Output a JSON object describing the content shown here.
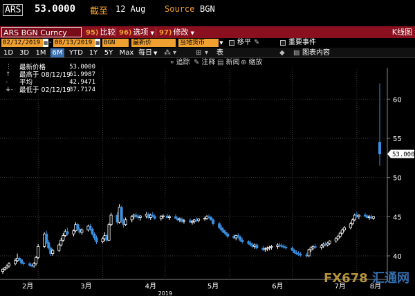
{
  "header": {
    "ticker": "ARS",
    "last_price": "53.0000",
    "asof_label": "截至",
    "asof_date": "12 Aug",
    "source_label": "Source",
    "source_value": "BGN"
  },
  "toolbar": {
    "security": "ARS BGN Curncy",
    "compare_num": "95)",
    "compare_label": "比较",
    "options_num": "96)",
    "options_label": "选项",
    "edit_num": "97)",
    "edit_label": "修改",
    "chart_type": "K线图"
  },
  "params": {
    "start_date": "02/12/2019",
    "end_date": "08/13/2019",
    "pricing_source": "BGN",
    "field": "最新价",
    "currency": "当地货币",
    "move_label": "移平",
    "events_label": "重要事件"
  },
  "periods": [
    "1D",
    "3D",
    "1M",
    "6M",
    "YTD",
    "1Y",
    "5Y",
    "Max"
  ],
  "active_period": "6M",
  "frequency": "每日",
  "view_label": "表",
  "chart_content_label": "图表内容",
  "tools": {
    "track": "追踪",
    "annotate": "注释",
    "news": "新闻",
    "zoom": "缩放"
  },
  "legend": {
    "last_label": "最新价格",
    "last_value": "53.0000",
    "high_label": "最高于 08/12/19",
    "high_value": "61.9987",
    "avg_label": "平均",
    "avg_value": "42.9471",
    "low_label": "最低于 02/12/19",
    "low_value": "37.7174"
  },
  "watermark": {
    "latin": "FX678",
    "cn": "汇通网"
  },
  "colors": {
    "up_candle": "#ffffff",
    "down_candle": "#3a8fe0",
    "accent_orange": "#f0a030",
    "toolbar_red": "#8a1020",
    "active_blue": "#3a6fb0"
  },
  "chart_data": {
    "type": "candlestick",
    "x_ticks": [
      "2月",
      "3月",
      "4月",
      "5月",
      "6月",
      "7月",
      "8月"
    ],
    "x_sublabel": "2019",
    "y_ticks": [
      40,
      45,
      50,
      55,
      60
    ],
    "ylim": [
      37,
      64
    ],
    "last_price_label": "53.0000",
    "grid": true,
    "candles": [
      {
        "d": "2019-02-12",
        "o": 38.0,
        "h": 38.4,
        "l": 37.72,
        "c": 38.3
      },
      {
        "d": "2019-02-13",
        "o": 38.3,
        "h": 38.6,
        "l": 38.1,
        "c": 38.5
      },
      {
        "d": "2019-02-14",
        "o": 38.5,
        "h": 38.9,
        "l": 38.3,
        "c": 38.7
      },
      {
        "d": "2019-02-15",
        "o": 38.7,
        "h": 39.2,
        "l": 38.5,
        "c": 39.0
      },
      {
        "d": "2019-02-18",
        "o": 39.0,
        "h": 39.7,
        "l": 38.8,
        "c": 39.4
      },
      {
        "d": "2019-02-19",
        "o": 39.4,
        "h": 40.3,
        "l": 39.2,
        "c": 39.7
      },
      {
        "d": "2019-02-20",
        "o": 39.7,
        "h": 39.9,
        "l": 39.3,
        "c": 39.5
      },
      {
        "d": "2019-02-21",
        "o": 39.5,
        "h": 39.6,
        "l": 38.9,
        "c": 39.1
      },
      {
        "d": "2019-02-22",
        "o": 39.1,
        "h": 39.3,
        "l": 38.8,
        "c": 39.0
      },
      {
        "d": "2019-02-25",
        "o": 39.0,
        "h": 39.2,
        "l": 38.6,
        "c": 38.8
      },
      {
        "d": "2019-02-26",
        "o": 38.8,
        "h": 39.0,
        "l": 38.5,
        "c": 38.7
      },
      {
        "d": "2019-02-27",
        "o": 38.7,
        "h": 39.2,
        "l": 38.5,
        "c": 39.0
      },
      {
        "d": "2019-02-28",
        "o": 39.0,
        "h": 40.0,
        "l": 38.8,
        "c": 39.8
      },
      {
        "d": "2019-03-01",
        "o": 39.8,
        "h": 41.5,
        "l": 39.6,
        "c": 41.2
      },
      {
        "d": "2019-03-04",
        "o": 41.2,
        "h": 43.0,
        "l": 41.0,
        "c": 42.8
      },
      {
        "d": "2019-03-05",
        "o": 42.8,
        "h": 43.2,
        "l": 41.5,
        "c": 41.7
      },
      {
        "d": "2019-03-06",
        "o": 41.7,
        "h": 42.0,
        "l": 40.8,
        "c": 41.0
      },
      {
        "d": "2019-03-07",
        "o": 41.0,
        "h": 41.2,
        "l": 40.0,
        "c": 40.3
      },
      {
        "d": "2019-03-08",
        "o": 40.3,
        "h": 40.9,
        "l": 40.0,
        "c": 40.7
      },
      {
        "d": "2019-03-11",
        "o": 40.7,
        "h": 41.6,
        "l": 40.5,
        "c": 41.4
      },
      {
        "d": "2019-03-12",
        "o": 41.4,
        "h": 42.3,
        "l": 41.2,
        "c": 42.0
      },
      {
        "d": "2019-03-13",
        "o": 42.0,
        "h": 42.9,
        "l": 41.8,
        "c": 42.6
      },
      {
        "d": "2019-03-14",
        "o": 42.6,
        "h": 43.4,
        "l": 42.4,
        "c": 43.1
      },
      {
        "d": "2019-03-15",
        "o": 43.1,
        "h": 43.6,
        "l": 42.6,
        "c": 42.8
      },
      {
        "d": "2019-03-18",
        "o": 42.8,
        "h": 43.4,
        "l": 42.5,
        "c": 43.2
      },
      {
        "d": "2019-03-19",
        "o": 43.2,
        "h": 44.3,
        "l": 43.0,
        "c": 44.0
      },
      {
        "d": "2019-03-20",
        "o": 44.0,
        "h": 44.2,
        "l": 43.2,
        "c": 43.4
      },
      {
        "d": "2019-03-21",
        "o": 43.4,
        "h": 43.6,
        "l": 42.8,
        "c": 43.0
      },
      {
        "d": "2019-03-22",
        "o": 43.0,
        "h": 43.5,
        "l": 42.7,
        "c": 43.3
      },
      {
        "d": "2019-03-25",
        "o": 43.3,
        "h": 44.0,
        "l": 43.1,
        "c": 43.8
      },
      {
        "d": "2019-03-26",
        "o": 43.8,
        "h": 44.1,
        "l": 43.2,
        "c": 43.4
      },
      {
        "d": "2019-03-27",
        "o": 43.4,
        "h": 43.6,
        "l": 42.6,
        "c": 42.8
      },
      {
        "d": "2019-03-28",
        "o": 42.8,
        "h": 43.0,
        "l": 42.0,
        "c": 42.3
      },
      {
        "d": "2019-03-29",
        "o": 42.3,
        "h": 42.6,
        "l": 41.5,
        "c": 41.8
      },
      {
        "d": "2019-04-01",
        "o": 41.8,
        "h": 42.4,
        "l": 41.6,
        "c": 42.2
      },
      {
        "d": "2019-04-02",
        "o": 42.2,
        "h": 43.0,
        "l": 41.9,
        "c": 42.6
      },
      {
        "d": "2019-04-03",
        "o": 42.6,
        "h": 42.8,
        "l": 41.8,
        "c": 42.0
      },
      {
        "d": "2019-04-04",
        "o": 42.0,
        "h": 44.2,
        "l": 41.9,
        "c": 44.0
      },
      {
        "d": "2019-04-05",
        "o": 44.0,
        "h": 45.5,
        "l": 43.8,
        "c": 45.2
      },
      {
        "d": "2019-04-08",
        "o": 45.2,
        "h": 45.6,
        "l": 44.0,
        "c": 44.3
      },
      {
        "d": "2019-04-09",
        "o": 44.3,
        "h": 46.6,
        "l": 44.1,
        "c": 46.2
      },
      {
        "d": "2019-04-10",
        "o": 46.2,
        "h": 46.4,
        "l": 44.2,
        "c": 44.5
      },
      {
        "d": "2019-04-11",
        "o": 44.5,
        "h": 44.8,
        "l": 43.6,
        "c": 44.0
      },
      {
        "d": "2019-04-12",
        "o": 44.0,
        "h": 44.9,
        "l": 43.8,
        "c": 44.6
      },
      {
        "d": "2019-04-15",
        "o": 44.6,
        "h": 45.2,
        "l": 44.3,
        "c": 45.0
      },
      {
        "d": "2019-04-16",
        "o": 45.0,
        "h": 45.4,
        "l": 44.7,
        "c": 45.2
      },
      {
        "d": "2019-04-17",
        "o": 45.2,
        "h": 45.5,
        "l": 44.8,
        "c": 45.0
      },
      {
        "d": "2019-04-18",
        "o": 45.0,
        "h": 45.3,
        "l": 44.6,
        "c": 44.9
      },
      {
        "d": "2019-04-19",
        "o": 44.9,
        "h": 45.2,
        "l": 44.5,
        "c": 45.1
      },
      {
        "d": "2019-04-22",
        "o": 45.1,
        "h": 45.6,
        "l": 44.8,
        "c": 45.3
      },
      {
        "d": "2019-04-23",
        "o": 45.3,
        "h": 45.5,
        "l": 44.7,
        "c": 44.9
      },
      {
        "d": "2019-04-24",
        "o": 44.9,
        "h": 45.4,
        "l": 44.6,
        "c": 45.2
      },
      {
        "d": "2019-04-25",
        "o": 45.2,
        "h": 45.6,
        "l": 44.9,
        "c": 45.0
      },
      {
        "d": "2019-04-26",
        "o": 45.0,
        "h": 45.3,
        "l": 44.6,
        "c": 44.8
      },
      {
        "d": "2019-04-29",
        "o": 44.8,
        "h": 45.2,
        "l": 44.5,
        "c": 45.0
      },
      {
        "d": "2019-04-30",
        "o": 45.0,
        "h": 45.3,
        "l": 44.7,
        "c": 45.1
      },
      {
        "d": "2019-05-02",
        "o": 45.1,
        "h": 45.4,
        "l": 44.8,
        "c": 44.9
      },
      {
        "d": "2019-05-03",
        "o": 44.9,
        "h": 45.2,
        "l": 44.6,
        "c": 45.0
      },
      {
        "d": "2019-05-06",
        "o": 45.0,
        "h": 45.3,
        "l": 44.7,
        "c": 44.8
      },
      {
        "d": "2019-05-07",
        "o": 44.8,
        "h": 45.0,
        "l": 44.4,
        "c": 44.6
      },
      {
        "d": "2019-05-08",
        "o": 44.6,
        "h": 44.9,
        "l": 44.3,
        "c": 44.7
      },
      {
        "d": "2019-05-09",
        "o": 44.7,
        "h": 44.9,
        "l": 44.2,
        "c": 44.4
      },
      {
        "d": "2019-05-10",
        "o": 44.4,
        "h": 44.7,
        "l": 44.1,
        "c": 44.5
      },
      {
        "d": "2019-05-13",
        "o": 44.5,
        "h": 44.8,
        "l": 44.2,
        "c": 44.3
      },
      {
        "d": "2019-05-14",
        "o": 44.3,
        "h": 44.6,
        "l": 44.0,
        "c": 44.4
      },
      {
        "d": "2019-05-15",
        "o": 44.4,
        "h": 44.7,
        "l": 44.1,
        "c": 44.6
      },
      {
        "d": "2019-05-16",
        "o": 44.6,
        "h": 44.9,
        "l": 44.3,
        "c": 44.5
      },
      {
        "d": "2019-05-17",
        "o": 44.5,
        "h": 44.8,
        "l": 44.3,
        "c": 44.7
      },
      {
        "d": "2019-05-20",
        "o": 44.7,
        "h": 45.0,
        "l": 44.5,
        "c": 44.8
      },
      {
        "d": "2019-05-21",
        "o": 44.8,
        "h": 45.2,
        "l": 44.6,
        "c": 45.0
      },
      {
        "d": "2019-05-22",
        "o": 45.0,
        "h": 45.3,
        "l": 44.7,
        "c": 44.9
      },
      {
        "d": "2019-05-23",
        "o": 44.9,
        "h": 45.1,
        "l": 44.5,
        "c": 44.6
      },
      {
        "d": "2019-05-24",
        "o": 44.6,
        "h": 44.8,
        "l": 43.9,
        "c": 44.1
      },
      {
        "d": "2019-05-27",
        "o": 44.1,
        "h": 44.3,
        "l": 43.4,
        "c": 43.6
      },
      {
        "d": "2019-05-28",
        "o": 43.6,
        "h": 43.9,
        "l": 43.1,
        "c": 43.3
      },
      {
        "d": "2019-05-29",
        "o": 43.3,
        "h": 43.6,
        "l": 42.9,
        "c": 43.0
      },
      {
        "d": "2019-05-30",
        "o": 43.0,
        "h": 43.3,
        "l": 42.6,
        "c": 42.8
      },
      {
        "d": "2019-05-31",
        "o": 42.8,
        "h": 43.0,
        "l": 42.3,
        "c": 42.5
      },
      {
        "d": "2019-06-03",
        "o": 42.5,
        "h": 42.8,
        "l": 42.1,
        "c": 42.3
      },
      {
        "d": "2019-06-04",
        "o": 42.3,
        "h": 42.7,
        "l": 42.0,
        "c": 42.6
      },
      {
        "d": "2019-06-05",
        "o": 42.6,
        "h": 42.9,
        "l": 42.2,
        "c": 42.4
      },
      {
        "d": "2019-06-06",
        "o": 42.4,
        "h": 42.6,
        "l": 41.8,
        "c": 42.0
      },
      {
        "d": "2019-06-07",
        "o": 42.0,
        "h": 42.3,
        "l": 41.6,
        "c": 41.8
      },
      {
        "d": "2019-06-10",
        "o": 41.8,
        "h": 42.0,
        "l": 41.4,
        "c": 41.6
      },
      {
        "d": "2019-06-11",
        "o": 41.6,
        "h": 41.9,
        "l": 41.2,
        "c": 41.4
      },
      {
        "d": "2019-06-12",
        "o": 41.4,
        "h": 41.7,
        "l": 41.0,
        "c": 41.2
      },
      {
        "d": "2019-06-13",
        "o": 41.2,
        "h": 41.6,
        "l": 40.9,
        "c": 41.4
      },
      {
        "d": "2019-06-14",
        "o": 41.4,
        "h": 41.6,
        "l": 40.8,
        "c": 41.0
      },
      {
        "d": "2019-06-17",
        "o": 41.0,
        "h": 41.3,
        "l": 40.6,
        "c": 40.8
      },
      {
        "d": "2019-06-18",
        "o": 40.8,
        "h": 41.1,
        "l": 40.5,
        "c": 40.9
      },
      {
        "d": "2019-06-19",
        "o": 40.9,
        "h": 41.2,
        "l": 40.6,
        "c": 41.0
      },
      {
        "d": "2019-06-20",
        "o": 41.0,
        "h": 41.3,
        "l": 40.7,
        "c": 41.1
      },
      {
        "d": "2019-06-21",
        "o": 41.1,
        "h": 41.4,
        "l": 40.8,
        "c": 41.2
      },
      {
        "d": "2019-06-24",
        "o": 41.2,
        "h": 41.6,
        "l": 40.9,
        "c": 41.4
      },
      {
        "d": "2019-06-25",
        "o": 41.4,
        "h": 41.7,
        "l": 41.1,
        "c": 41.3
      },
      {
        "d": "2019-06-26",
        "o": 41.3,
        "h": 41.6,
        "l": 41.0,
        "c": 41.2
      },
      {
        "d": "2019-06-27",
        "o": 41.2,
        "h": 41.5,
        "l": 40.9,
        "c": 41.1
      },
      {
        "d": "2019-06-28",
        "o": 41.1,
        "h": 41.4,
        "l": 40.8,
        "c": 41.0
      },
      {
        "d": "2019-07-01",
        "o": 41.0,
        "h": 41.2,
        "l": 40.6,
        "c": 40.7
      },
      {
        "d": "2019-07-02",
        "o": 40.7,
        "h": 40.9,
        "l": 40.3,
        "c": 40.4
      },
      {
        "d": "2019-07-03",
        "o": 40.4,
        "h": 40.7,
        "l": 40.1,
        "c": 40.3
      },
      {
        "d": "2019-07-04",
        "o": 40.3,
        "h": 40.6,
        "l": 40.0,
        "c": 40.2
      },
      {
        "d": "2019-07-05",
        "o": 40.2,
        "h": 40.5,
        "l": 39.9,
        "c": 40.1
      },
      {
        "d": "2019-07-08",
        "o": 40.1,
        "h": 40.4,
        "l": 39.8,
        "c": 40.0
      },
      {
        "d": "2019-07-09",
        "o": 40.0,
        "h": 40.9,
        "l": 39.9,
        "c": 40.8
      },
      {
        "d": "2019-07-10",
        "o": 40.8,
        "h": 41.2,
        "l": 40.5,
        "c": 41.0
      },
      {
        "d": "2019-07-11",
        "o": 41.0,
        "h": 41.4,
        "l": 40.7,
        "c": 41.2
      },
      {
        "d": "2019-07-12",
        "o": 41.2,
        "h": 41.5,
        "l": 40.9,
        "c": 41.1
      },
      {
        "d": "2019-07-15",
        "o": 41.1,
        "h": 41.5,
        "l": 40.8,
        "c": 41.3
      },
      {
        "d": "2019-07-16",
        "o": 41.3,
        "h": 41.7,
        "l": 41.0,
        "c": 41.5
      },
      {
        "d": "2019-07-17",
        "o": 41.5,
        "h": 41.8,
        "l": 41.2,
        "c": 41.4
      },
      {
        "d": "2019-07-18",
        "o": 41.4,
        "h": 41.8,
        "l": 41.2,
        "c": 41.6
      },
      {
        "d": "2019-07-19",
        "o": 41.6,
        "h": 42.0,
        "l": 41.4,
        "c": 41.9
      },
      {
        "d": "2019-07-22",
        "o": 41.9,
        "h": 42.4,
        "l": 41.7,
        "c": 42.2
      },
      {
        "d": "2019-07-23",
        "o": 42.2,
        "h": 42.7,
        "l": 42.0,
        "c": 42.5
      },
      {
        "d": "2019-07-24",
        "o": 42.5,
        "h": 43.1,
        "l": 42.3,
        "c": 42.9
      },
      {
        "d": "2019-07-25",
        "o": 42.9,
        "h": 43.5,
        "l": 42.7,
        "c": 43.3
      },
      {
        "d": "2019-07-26",
        "o": 43.3,
        "h": 43.8,
        "l": 43.1,
        "c": 43.6
      },
      {
        "d": "2019-07-29",
        "o": 43.6,
        "h": 44.3,
        "l": 43.4,
        "c": 44.1
      },
      {
        "d": "2019-07-30",
        "o": 44.1,
        "h": 44.8,
        "l": 43.9,
        "c": 44.6
      },
      {
        "d": "2019-07-31",
        "o": 44.6,
        "h": 45.4,
        "l": 44.4,
        "c": 45.2
      },
      {
        "d": "2019-08-01",
        "o": 45.2,
        "h": 45.6,
        "l": 44.8,
        "c": 45.0
      },
      {
        "d": "2019-08-02",
        "o": 45.0,
        "h": 45.3,
        "l": 44.7,
        "c": 45.2
      },
      {
        "d": "2019-08-05",
        "o": 45.2,
        "h": 45.5,
        "l": 44.9,
        "c": 45.1
      },
      {
        "d": "2019-08-06",
        "o": 45.1,
        "h": 45.3,
        "l": 44.8,
        "c": 44.9
      },
      {
        "d": "2019-08-07",
        "o": 44.9,
        "h": 45.2,
        "l": 44.6,
        "c": 45.0
      },
      {
        "d": "2019-08-08",
        "o": 45.0,
        "h": 45.3,
        "l": 44.7,
        "c": 44.8
      },
      {
        "d": "2019-08-09",
        "o": 44.8,
        "h": 45.1,
        "l": 44.6,
        "c": 45.0
      },
      {
        "d": "2019-08-12",
        "o": 54.5,
        "h": 61.9987,
        "l": 51.5,
        "c": 53.0
      }
    ]
  }
}
